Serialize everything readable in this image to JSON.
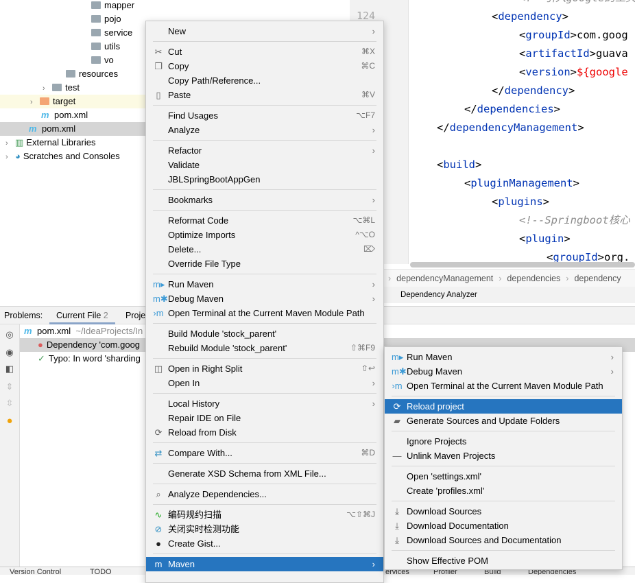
{
  "project_tree": [
    {
      "label": "mapper",
      "icon": "package-folder-icon",
      "indent": 133
    },
    {
      "label": "pojo",
      "icon": "package-folder-icon",
      "indent": 133
    },
    {
      "label": "service",
      "icon": "package-folder-icon",
      "indent": 133
    },
    {
      "label": "utils",
      "icon": "package-folder-icon",
      "indent": 133
    },
    {
      "label": "vo",
      "icon": "package-folder-icon",
      "indent": 133
    },
    {
      "label": "resources",
      "icon": "resources-folder-icon",
      "indent": 96
    },
    {
      "label": "test",
      "icon": "folder-icon",
      "indent": 62,
      "expandable": true
    },
    {
      "label": "target",
      "icon": "excluded-folder-icon",
      "indent": 44,
      "expandable": true,
      "state": "highlighted"
    },
    {
      "label": "pom.xml",
      "icon": "maven-icon",
      "indent": 60
    },
    {
      "label": "pom.xml",
      "icon": "maven-icon",
      "indent": 42,
      "state": "selected"
    },
    {
      "label": "External Libraries",
      "icon": "libraries-icon",
      "indent": 8,
      "expandable": true
    },
    {
      "label": "Scratches and Consoles",
      "icon": "scratches-icon",
      "indent": 8,
      "expandable": true
    }
  ],
  "editor": {
    "line_number_visible": "124",
    "lines": [
      {
        "indent": 3,
        "parts": [
          [
            "cmt",
            "<!--引入google的工具类"
          ]
        ]
      },
      {
        "indent": 2,
        "parts": [
          [
            "br",
            "<"
          ],
          [
            "tag",
            "dependency"
          ],
          [
            "br",
            ">"
          ]
        ]
      },
      {
        "indent": 3,
        "parts": [
          [
            "br",
            "<"
          ],
          [
            "tag",
            "groupId"
          ],
          [
            "br",
            ">"
          ],
          [
            "val",
            "com.goog"
          ]
        ]
      },
      {
        "indent": 3,
        "parts": [
          [
            "br",
            "<"
          ],
          [
            "tag",
            "artifactId"
          ],
          [
            "br",
            ">"
          ],
          [
            "val",
            "guava"
          ]
        ]
      },
      {
        "indent": 3,
        "parts": [
          [
            "br",
            "<"
          ],
          [
            "tag",
            "version"
          ],
          [
            "br",
            ">"
          ],
          [
            "red",
            "${google"
          ]
        ]
      },
      {
        "indent": 2,
        "parts": [
          [
            "br",
            "</"
          ],
          [
            "tag",
            "dependency"
          ],
          [
            "br",
            ">"
          ]
        ]
      },
      {
        "indent": 1,
        "parts": [
          [
            "br",
            "</"
          ],
          [
            "tag",
            "dependencies"
          ],
          [
            "br",
            ">"
          ]
        ]
      },
      {
        "indent": 0,
        "parts": [
          [
            "br",
            "</"
          ],
          [
            "tag",
            "dependencyManagement"
          ],
          [
            "br",
            ">"
          ]
        ]
      },
      {
        "indent": 0,
        "parts": []
      },
      {
        "indent": 0,
        "parts": [
          [
            "br",
            "<"
          ],
          [
            "tag",
            "build"
          ],
          [
            "br",
            ">"
          ]
        ]
      },
      {
        "indent": 1,
        "parts": [
          [
            "br",
            "<"
          ],
          [
            "tag",
            "pluginManagement"
          ],
          [
            "br",
            ">"
          ]
        ]
      },
      {
        "indent": 2,
        "parts": [
          [
            "br",
            "<"
          ],
          [
            "tag",
            "plugins"
          ],
          [
            "br",
            ">"
          ]
        ]
      },
      {
        "indent": 3,
        "parts": [
          [
            "cmt",
            "<!--Springboot核心"
          ]
        ]
      },
      {
        "indent": 3,
        "parts": [
          [
            "br",
            "<"
          ],
          [
            "tag",
            "plugin"
          ],
          [
            "br",
            ">"
          ]
        ]
      },
      {
        "indent": 4,
        "parts": [
          [
            "br",
            "<"
          ],
          [
            "tag",
            "groupId"
          ],
          [
            "br",
            ">"
          ],
          [
            "val",
            "org."
          ]
        ]
      }
    ],
    "breadcrumbs": [
      "dependencyManagement",
      "dependencies",
      "dependency"
    ],
    "bottom_tab": "Dependency Analyzer"
  },
  "problems": {
    "label": "Problems:",
    "tabs": [
      {
        "label": "Current File",
        "count": "2"
      },
      {
        "label": "Proje"
      }
    ],
    "file": "pom.xml",
    "path": "~/IdeaProjects/In",
    "items": [
      {
        "text": "Dependency 'com.goog",
        "icon": "error-icon"
      },
      {
        "text": "Typo: In word 'sharding",
        "icon": "typo-icon"
      }
    ]
  },
  "status_bar": [
    "Version Control",
    "TODO",
    "ervices",
    "Profiler",
    "Build",
    "Dependencies"
  ],
  "context_menu": [
    {
      "label": "New",
      "submenu": true
    },
    {
      "sep": true
    },
    {
      "label": "Cut",
      "icon": "✂",
      "icon_name": "scissors-icon",
      "shortcut": "⌘X"
    },
    {
      "label": "Copy",
      "icon": "❐",
      "icon_name": "copy-icon",
      "shortcut": "⌘C"
    },
    {
      "label": "Copy Path/Reference..."
    },
    {
      "label": "Paste",
      "icon": "▯",
      "icon_name": "clipboard-icon",
      "shortcut": "⌘V"
    },
    {
      "sep": true
    },
    {
      "label": "Find Usages",
      "shortcut": "⌥F7"
    },
    {
      "label": "Analyze",
      "submenu": true
    },
    {
      "sep": true
    },
    {
      "label": "Refactor",
      "submenu": true
    },
    {
      "label": "Validate"
    },
    {
      "label": "JBLSpringBootAppGen"
    },
    {
      "sep": true
    },
    {
      "label": "Bookmarks",
      "submenu": true
    },
    {
      "sep": true
    },
    {
      "label": "Reformat Code",
      "shortcut": "⌥⌘L"
    },
    {
      "label": "Optimize Imports",
      "shortcut": "^⌥O"
    },
    {
      "label": "Delete...",
      "shortcut": "⌦"
    },
    {
      "label": "Override File Type"
    },
    {
      "sep": true
    },
    {
      "label": "Run Maven",
      "icon": "m▸",
      "icon_name": "run-maven-icon",
      "submenu": true
    },
    {
      "label": "Debug Maven",
      "icon": "m✱",
      "icon_name": "debug-maven-icon",
      "submenu": true
    },
    {
      "label": "Open Terminal at the Current Maven Module Path",
      "icon": "›m",
      "icon_name": "terminal-maven-icon"
    },
    {
      "sep": true
    },
    {
      "label": "Build Module 'stock_parent'"
    },
    {
      "label": "Rebuild Module 'stock_parent'",
      "shortcut": "⇧⌘F9"
    },
    {
      "sep": true
    },
    {
      "label": "Open in Right Split",
      "icon": "◫",
      "icon_name": "split-icon",
      "shortcut": "⇧↩"
    },
    {
      "label": "Open In",
      "submenu": true
    },
    {
      "sep": true
    },
    {
      "label": "Local History",
      "submenu": true
    },
    {
      "label": "Repair IDE on File"
    },
    {
      "label": "Reload from Disk",
      "icon": "⟳",
      "icon_name": "reload-icon"
    },
    {
      "sep": true
    },
    {
      "label": "Compare With...",
      "icon": "⇄",
      "icon_name": "compare-icon",
      "shortcut": "⌘D"
    },
    {
      "sep": true
    },
    {
      "label": "Generate XSD Schema from XML File..."
    },
    {
      "sep": true
    },
    {
      "label": "Analyze Dependencies...",
      "icon": "⌕",
      "icon_name": "analyze-dependencies-icon"
    },
    {
      "sep": true
    },
    {
      "label": "编码规约扫描",
      "icon": "∿",
      "icon_name": "code-scan-icon",
      "shortcut": "⌥⇧⌘J"
    },
    {
      "label": "关闭实时检测功能",
      "icon": "⊘",
      "icon_name": "disable-icon"
    },
    {
      "label": "Create Gist...",
      "icon": "●",
      "icon_name": "github-icon"
    },
    {
      "sep": true
    },
    {
      "label": "Maven",
      "icon": "m",
      "icon_name": "maven-icon",
      "submenu": true,
      "active": true
    }
  ],
  "maven_submenu": [
    {
      "label": "Run Maven",
      "icon": "m▸",
      "icon_name": "run-maven-icon",
      "submenu": true
    },
    {
      "label": "Debug Maven",
      "icon": "m✱",
      "icon_name": "debug-maven-icon",
      "submenu": true
    },
    {
      "label": "Open Terminal at the Current Maven Module Path",
      "icon": "›m",
      "icon_name": "terminal-maven-icon"
    },
    {
      "sep": true
    },
    {
      "label": "Reload project",
      "icon": "⟳",
      "icon_name": "reload-icon",
      "active": true
    },
    {
      "label": "Generate Sources and Update Folders",
      "icon": "▰",
      "icon_name": "generate-sources-icon"
    },
    {
      "sep": true
    },
    {
      "label": "Ignore Projects"
    },
    {
      "label": "Unlink Maven Projects",
      "icon": "—",
      "icon_name": "minus-icon"
    },
    {
      "sep": true
    },
    {
      "label": "Open 'settings.xml'"
    },
    {
      "label": "Create 'profiles.xml'"
    },
    {
      "sep": true
    },
    {
      "label": "Download Sources",
      "icon": "⤓",
      "icon_name": "download-icon"
    },
    {
      "label": "Download Documentation",
      "icon": "⤓",
      "icon_name": "download-icon"
    },
    {
      "label": "Download Sources and Documentation",
      "icon": "⤓",
      "icon_name": "download-icon"
    },
    {
      "sep": true
    },
    {
      "label": "Show Effective POM"
    }
  ],
  "colors": {
    "selection": "#2675bf",
    "xml_tag": "#0033b3",
    "error_value": "#e00000",
    "maven": "#4fb8e8"
  }
}
